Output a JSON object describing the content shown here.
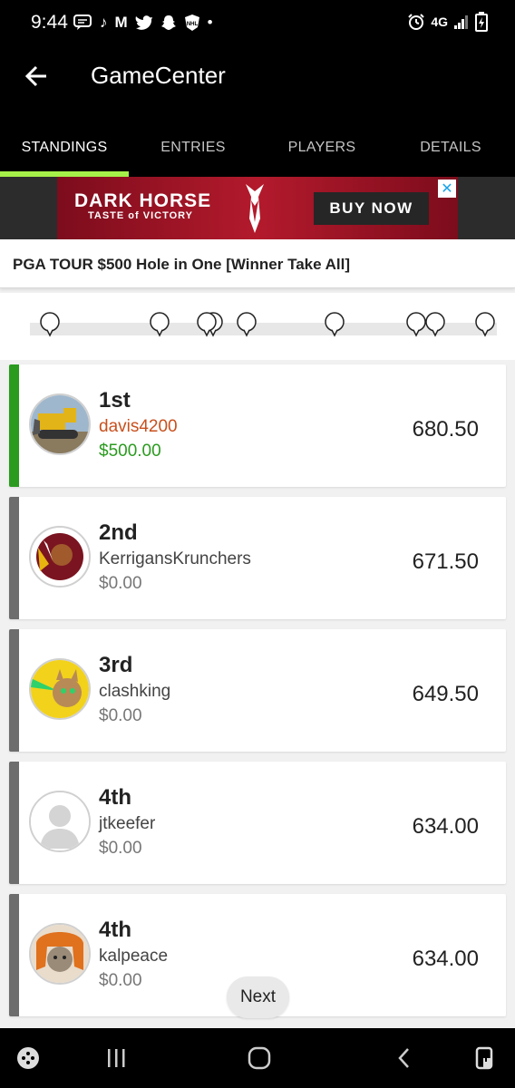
{
  "status_bar": {
    "time": "9:44",
    "network": "4G",
    "left_icons": [
      "message-icon",
      "tiktok-icon",
      "mcdonalds-icon",
      "twitter-icon",
      "snapchat-icon",
      "nhl-icon"
    ],
    "right_icons": [
      "alarm-icon",
      "network-4g-icon",
      "signal-icon",
      "battery-icon"
    ]
  },
  "app_bar": {
    "title": "GameCenter",
    "back_icon": "back-arrow-icon"
  },
  "tabs": [
    {
      "label": "STANDINGS",
      "active": true
    },
    {
      "label": "ENTRIES",
      "active": false
    },
    {
      "label": "PLAYERS",
      "active": false
    },
    {
      "label": "DETAILS",
      "active": false
    }
  ],
  "ad": {
    "brand": "DARK HORSE",
    "tagline": "TASTE of VICTORY",
    "cta": "BUY NOW",
    "close_label": "✕"
  },
  "contest": {
    "title": "PGA TOUR $500 Hole in One [Winner Take All]"
  },
  "standings": [
    {
      "rank": "1st",
      "username": "davis4200",
      "prize": "$500.00",
      "score": "680.50",
      "winner": true,
      "avatar": "bulldozer-avatar"
    },
    {
      "rank": "2nd",
      "username": "KerrigansKrunchers",
      "prize": "$0.00",
      "score": "671.50",
      "winner": false,
      "avatar": "redskins-logo-avatar"
    },
    {
      "rank": "3rd",
      "username": "clashking",
      "prize": "$0.00",
      "score": "649.50",
      "winner": false,
      "avatar": "laser-cat-avatar"
    },
    {
      "rank": "4th",
      "username": "jtkeefer",
      "prize": "$0.00",
      "score": "634.00",
      "winner": false,
      "avatar": "default-user-avatar"
    },
    {
      "rank": "4th",
      "username": "kalpeace",
      "prize": "$0.00",
      "score": "634.00",
      "winner": false,
      "avatar": "cat-wig-avatar"
    }
  ],
  "next_button": {
    "label": "Next"
  },
  "nav_bar": {
    "icons": [
      "game-launcher-icon",
      "recent-apps-icon",
      "home-icon",
      "back-icon",
      "screenshot-assist-icon"
    ]
  },
  "colors": {
    "accent": "#a6f04a",
    "winner": "#2b9b1f",
    "highlight_user": "#c8501d",
    "ad_red": "#b31a2c"
  }
}
